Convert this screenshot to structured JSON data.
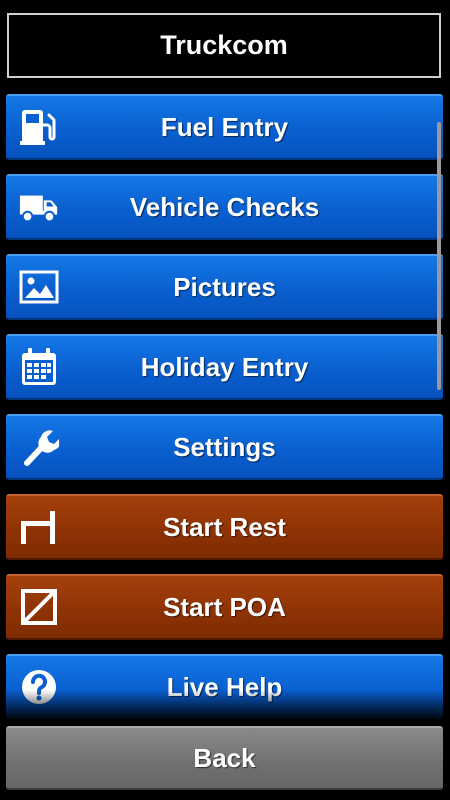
{
  "header": {
    "title": "Truckcom"
  },
  "menu": {
    "fuel_entry": "Fuel Entry",
    "vehicle_checks": "Vehicle Checks",
    "pictures": "Pictures",
    "holiday_entry": "Holiday Entry",
    "settings": "Settings",
    "start_rest": "Start Rest",
    "start_poa": "Start POA",
    "live_help": "Live Help"
  },
  "footer": {
    "back": "Back"
  },
  "colors": {
    "blue_button": "#0a5fd0",
    "brown_button": "#8f3305",
    "grey_button": "#727272"
  },
  "icons": {
    "fuel_entry": "fuel-pump-icon",
    "vehicle_checks": "truck-icon",
    "pictures": "picture-icon",
    "holiday_entry": "calendar-icon",
    "settings": "wrench-icon",
    "start_rest": "bed-icon",
    "start_poa": "poa-square-icon",
    "live_help": "help-circle-icon"
  }
}
